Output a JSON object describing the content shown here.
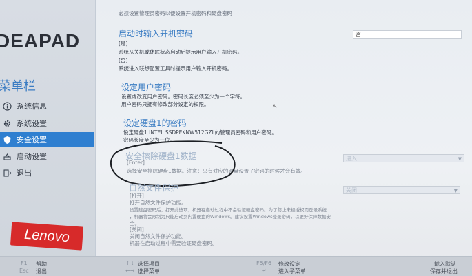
{
  "top_partial_text": "必须设置管理员密码以便设置开机密码和硬盘密码",
  "sidebar": {
    "logo": "DEAPAD",
    "menu_heading": "菜单栏",
    "items": [
      {
        "label": "系统信息",
        "icon": "info-icon"
      },
      {
        "label": "系统设置",
        "icon": "gear-icon"
      },
      {
        "label": "安全设置",
        "icon": "shield-icon",
        "active": true
      },
      {
        "label": "启动设置",
        "icon": "boot-icon"
      },
      {
        "label": "退出",
        "icon": "exit-icon"
      }
    ],
    "brand": "Lenovo"
  },
  "main": {
    "power_on_password": {
      "title": "启动时输入开机密码",
      "value": "否",
      "opt1": "[是]",
      "opt1_desc": "系统从关机或休眠状态启动后提示用户输入开机密码。",
      "opt2": "[否]",
      "opt2_desc": "系统进入联想配置工具时提示用户输入开机密码。"
    },
    "set_user_password": {
      "title": "设定用户密码",
      "desc1": "设置或改变用户密码。密码长度必须至少为一个字符。",
      "desc2": "用户密码只拥有修改部分设定的权限。"
    },
    "set_hdd_password": {
      "title": "设定硬盘1的密码",
      "desc1": "设定硬盘1 INTEL SSDPEKNW512GZL的管理员密码和用户密码。",
      "desc2": "密码长度至少为一位。"
    },
    "secure_erase": {
      "title": "安全擦除硬盘1数据",
      "value": "进入",
      "opt": "[Enter]",
      "desc": "选择安全擦除硬盘1数据。注意：只有对应的硬盘设置了密码的时候才会有效。"
    },
    "natural_file_protection": {
      "title": "自然文件保护",
      "value": "关闭",
      "opt1": "[打开]",
      "opt1_desc": "打开自然文件保护功能。",
      "opt1_desc2": "设置建盘密码后，打开此选项，机器在启动过程中不会验证硬盘密码。为了防止未经授权而登录系统",
      "opt1_desc3": "，机器将会限制为只能启动到内置硬盘的Windows。建议设置Windows登录密码，以更好保障数据安",
      "opt1_desc4": "全。",
      "opt2": "[关闭]",
      "opt2_desc": "关闭自然文件保护功能。",
      "opt2_desc2": "机器在启动过程中需要验证硬盘密码。"
    }
  },
  "bottom_bar": {
    "help_key": "F1",
    "help_label": "帮助",
    "exit_key": "Esc",
    "exit_label": "退出",
    "select_item": "选择项目",
    "select_menu": "选择菜单",
    "modify_key": "F5/F6",
    "modify_label": "修改设定",
    "enter_sub": "进入子菜单",
    "defaults_label": "载入默认",
    "save_exit_label": "保存并退出"
  }
}
